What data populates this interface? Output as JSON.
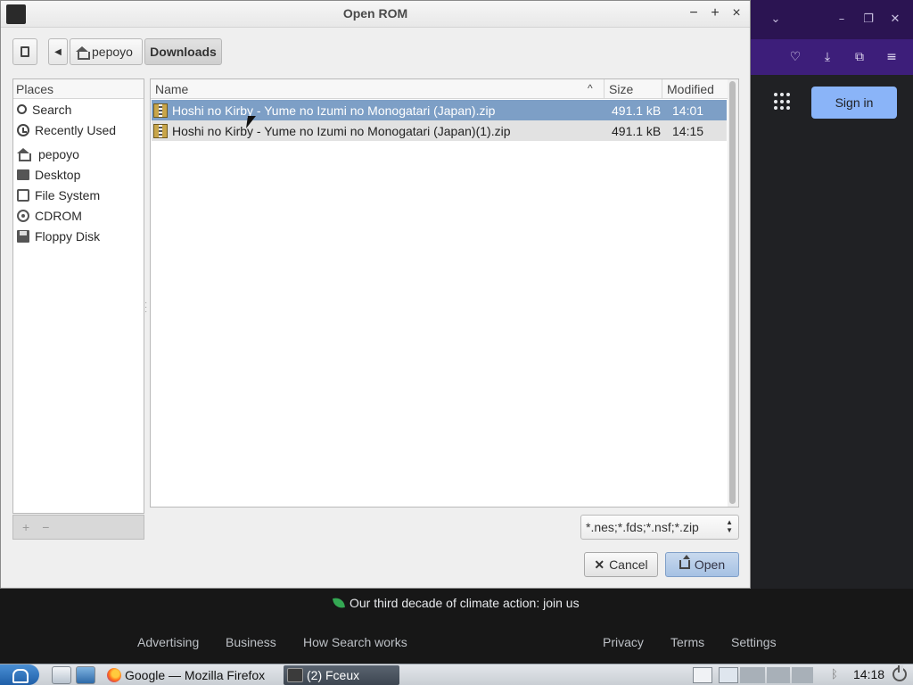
{
  "dialog": {
    "title": "Open ROM",
    "path": {
      "home": "pepoyo",
      "current": "Downloads"
    },
    "places_header": "Places",
    "places": [
      {
        "label": "Search",
        "icon": "search-icon"
      },
      {
        "label": "Recently Used",
        "icon": "clock-icon"
      },
      {
        "label": "pepoyo",
        "icon": "home-icon"
      },
      {
        "label": "Desktop",
        "icon": "desktop-icon"
      },
      {
        "label": "File System",
        "icon": "drive-icon"
      },
      {
        "label": "CDROM",
        "icon": "cdrom-icon"
      },
      {
        "label": "Floppy Disk",
        "icon": "floppy-icon"
      }
    ],
    "places_buttons": {
      "add": "+",
      "remove": "−"
    },
    "columns": {
      "name": "Name",
      "size": "Size",
      "modified": "Modified"
    },
    "files": [
      {
        "name": "Hoshi no Kirby - Yume no Izumi no Monogatari (Japan).zip",
        "size": "491.1 kB",
        "modified": "14:01",
        "selected": true
      },
      {
        "name": "Hoshi no Kirby - Yume no Izumi no Monogatari (Japan)(1).zip",
        "size": "491.1 kB",
        "modified": "14:15",
        "selected": false
      }
    ],
    "filter": "*.nes;*.fds;*.nsf;*.zip",
    "cancel_label": "Cancel",
    "open_label": "Open",
    "window_controls": {
      "minimize": "−",
      "maximize": "+",
      "close": "×"
    }
  },
  "browser": {
    "signin_label": "Sign in",
    "climate_text": "Our third decade of climate action: join us",
    "footer_left": [
      "Advertising",
      "Business",
      "How Search works"
    ],
    "footer_right": [
      "Privacy",
      "Terms",
      "Settings"
    ]
  },
  "taskbar": {
    "tasks": [
      {
        "label": "Google — Mozilla Firefox"
      },
      {
        "label": "(2) Fceux"
      }
    ],
    "clock": "14:18"
  },
  "colors": {
    "selection": "#7d9fc6",
    "firefox_toolbar": "#3d1e7a",
    "google_signin": "#8ab4f8"
  }
}
